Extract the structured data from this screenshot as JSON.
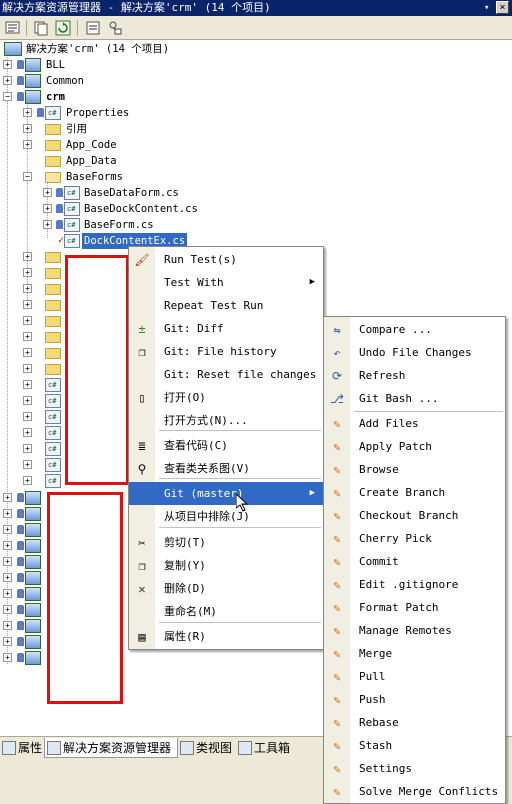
{
  "window": {
    "title": "解决方案资源管理器 - 解决方案'crm' (14 个项目)",
    "close_glyph": "×",
    "pin_glyph": "▾"
  },
  "toolbar": {
    "icons": [
      "properties-icon",
      "refresh-icon",
      "show-all-files-icon",
      "view-code-icon",
      "class-diagram-icon"
    ]
  },
  "tree": {
    "solution": "解决方案'crm' (14 个项目)",
    "items": [
      {
        "label": "BLL",
        "kind": "project"
      },
      {
        "label": "Common",
        "kind": "project"
      },
      {
        "label": "crm",
        "kind": "project"
      },
      {
        "label": "Properties",
        "kind": "properties"
      },
      {
        "label": "引用",
        "kind": "references"
      },
      {
        "label": "App_Code",
        "kind": "folder"
      },
      {
        "label": "App_Data",
        "kind": "folder"
      },
      {
        "label": "BaseForms",
        "kind": "folder"
      },
      {
        "label": "BaseDataForm.cs",
        "kind": "csfile"
      },
      {
        "label": "BaseDockContent.cs",
        "kind": "csfile"
      },
      {
        "label": "BaseForm.cs",
        "kind": "csfile"
      },
      {
        "label": "DockContentEx.cs",
        "kind": "csfile",
        "selected": true
      }
    ]
  },
  "context_menu": {
    "items": [
      {
        "label": "Run Test(s)",
        "icon": "run-test-icon"
      },
      {
        "label": "Test With",
        "submenu": true
      },
      {
        "label": "Repeat Test Run"
      },
      {
        "label": "Git: Diff",
        "icon": "diff-icon"
      },
      {
        "label": "Git: File history",
        "icon": "history-icon"
      },
      {
        "label": "Git: Reset file changes"
      },
      {
        "label": "打开(O)",
        "icon": "open-icon"
      },
      {
        "label": "打开方式(N)..."
      },
      {
        "label": "查看代码(C)",
        "icon": "view-code-icon"
      },
      {
        "label": "查看类关系图(V)",
        "icon": "class-diagram-icon"
      },
      {
        "label": "Git (master)",
        "submenu": true,
        "highlighted": true
      },
      {
        "label": "从项目中排除(J)"
      },
      {
        "label": "剪切(T)",
        "icon": "cut-icon"
      },
      {
        "label": "复制(Y)",
        "icon": "copy-icon"
      },
      {
        "label": "删除(D)",
        "icon": "delete-icon"
      },
      {
        "label": "重命名(M)"
      },
      {
        "label": "属性(R)",
        "icon": "properties-icon"
      }
    ]
  },
  "git_submenu": {
    "items": [
      "Compare ...",
      "Undo File Changes",
      "Refresh",
      "Git Bash ...",
      "Add Files",
      "Apply Patch",
      "Browse",
      "Create Branch",
      "Checkout Branch",
      "Cherry Pick",
      "Commit",
      "Edit .gitignore",
      "Format Patch",
      "Manage Remotes",
      "Merge",
      "Pull",
      "Push",
      "Rebase",
      "Stash",
      "Settings",
      "Solve Merge Conflicts"
    ]
  },
  "bottom_tabs": [
    {
      "label": "属性"
    },
    {
      "label": "解决方案资源管理器",
      "active": true
    },
    {
      "label": "类视图"
    },
    {
      "label": "工具箱"
    }
  ],
  "colors": {
    "title_bg": "#0a246a",
    "highlight": "#316ac5",
    "redact_border": "#e01010",
    "git_icon": "#e06a1a"
  }
}
